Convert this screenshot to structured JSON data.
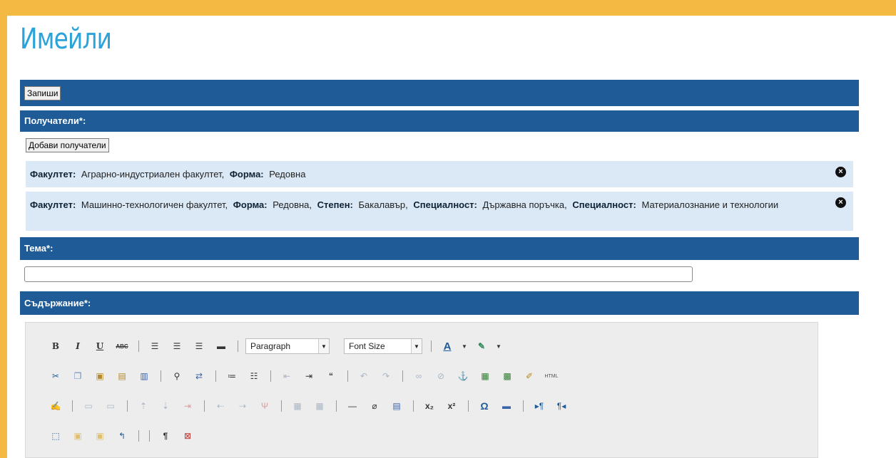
{
  "page_title": "Имейли",
  "toolbar": {
    "save_label": "Запиши"
  },
  "recipients": {
    "header": "Получатели*:",
    "add_button": "Добави получатели",
    "items": [
      {
        "fields": [
          {
            "label": "Факултет:",
            "value": "Аграрно-индустриален факултет,"
          },
          {
            "label": "Форма:",
            "value": "Редовна"
          }
        ]
      },
      {
        "fields": [
          {
            "label": "Факултет:",
            "value": "Машинно-технологичен факултет,"
          },
          {
            "label": "Форма:",
            "value": "Редовна,"
          },
          {
            "label": "Степен:",
            "value": "Бакалавър,"
          },
          {
            "label": "Специалност:",
            "value": "Държавна поръчка,"
          },
          {
            "label": "Специалност:",
            "value": "Материалознание и технологии"
          }
        ]
      }
    ]
  },
  "subject": {
    "header": "Тема*:",
    "value": ""
  },
  "content": {
    "header": "Съдържание*:",
    "format_select": "Paragraph",
    "font_size_select": "Font Size"
  },
  "colors": {
    "brand_bar": "#1e5b97",
    "title": "#2aa3da",
    "frame": "#f4b942",
    "recipient_bg": "#dbe9f7"
  }
}
